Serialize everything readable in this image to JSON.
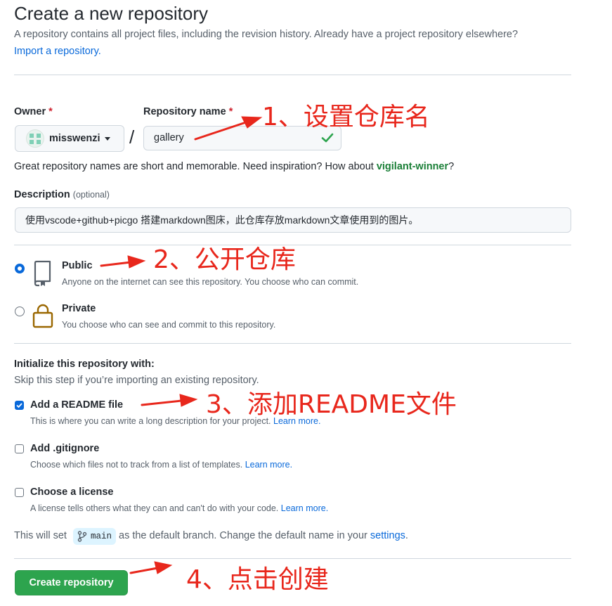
{
  "header": {
    "title": "Create a new repository",
    "subtitle": "A repository contains all project files, including the revision history. Already have a project repository elsewhere?",
    "import_link": "Import a repository."
  },
  "owner": {
    "label": "Owner",
    "required_mark": "*",
    "value": "misswenzi"
  },
  "repo_name": {
    "label": "Repository name",
    "required_mark": "*",
    "value": "gallery",
    "separator": "/"
  },
  "name_hint": {
    "prefix": "Great repository names are short and memorable. Need inspiration? How about ",
    "suggestion": "vigilant-winner",
    "suffix": "?"
  },
  "description": {
    "label": "Description",
    "optional": "(optional)",
    "value": "使用vscode+github+picgo 搭建markdown图床，此仓库存放markdown文章使用到的图片。"
  },
  "visibility": {
    "public": {
      "title": "Public",
      "note": "Anyone on the internet can see this repository. You choose who can commit.",
      "selected": true
    },
    "private": {
      "title": "Private",
      "note": "You choose who can see and commit to this repository.",
      "selected": false
    }
  },
  "init": {
    "title": "Initialize this repository with:",
    "note": "Skip this step if you’re importing an existing repository.",
    "readme": {
      "label": "Add a README file",
      "note": "This is where you can write a long description for your project.",
      "learn": "Learn more.",
      "checked": true
    },
    "gitignore": {
      "label": "Add .gitignore",
      "note": "Choose which files not to track from a list of templates.",
      "learn": "Learn more.",
      "checked": false
    },
    "license": {
      "label": "Choose a license",
      "note": "A license tells others what they can and can't do with your code.",
      "learn": "Learn more.",
      "checked": false
    }
  },
  "branch": {
    "prefix": "This will set",
    "name": "main",
    "middle": "as the default branch. Change the default name in your",
    "settings_link": "settings",
    "suffix": "."
  },
  "submit": {
    "label": "Create repository"
  },
  "annotations": {
    "a1": "1、设置仓库名",
    "a2": "2、公开仓库",
    "a3": "3、添加README文件",
    "a4": "4、点击创建"
  },
  "colors": {
    "accent": "#0969da",
    "success": "#2da44e",
    "annotation": "#e8271c"
  }
}
